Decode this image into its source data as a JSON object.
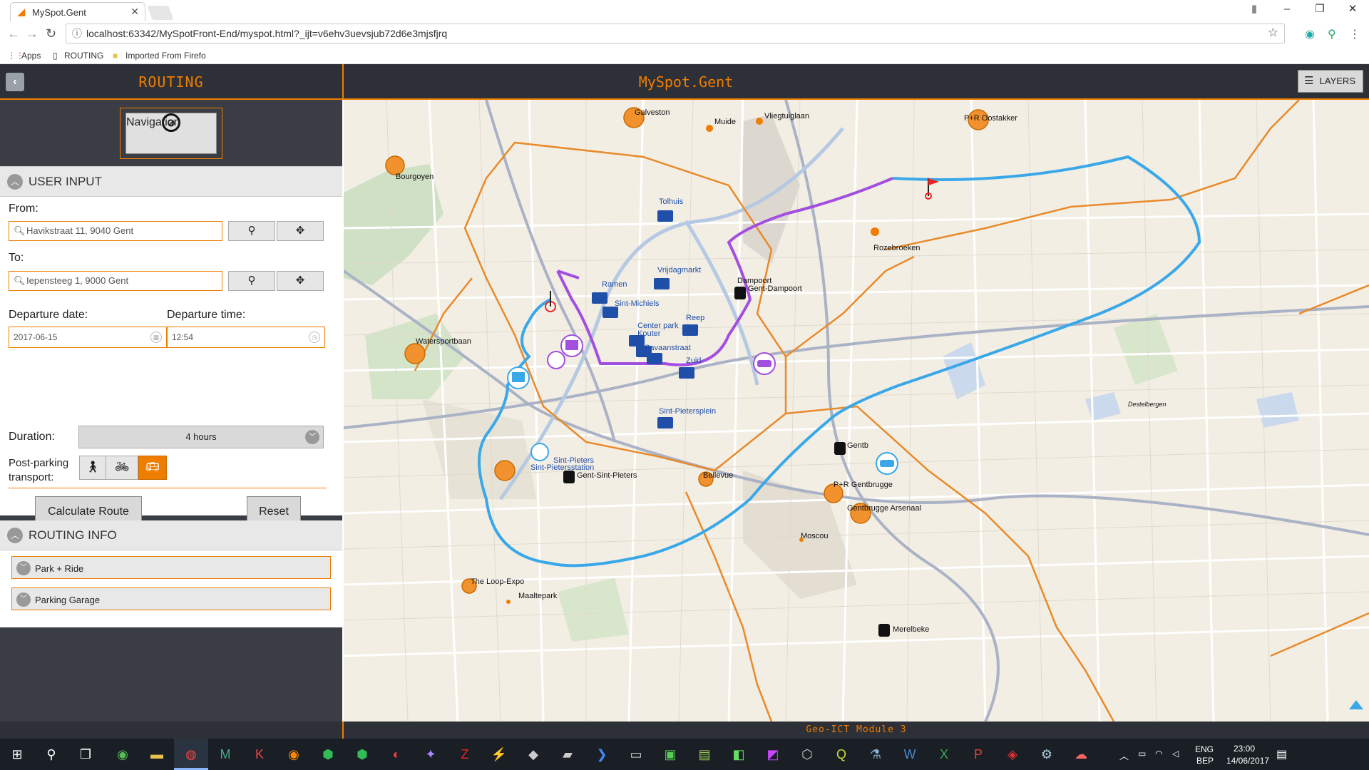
{
  "browser": {
    "tab_title": "MySpot.Gent",
    "tab_close": "✕",
    "url": "localhost:63342/MySpotFront-End/myspot.html?_ijt=v6ehv3uevsjub72d6e3mjsfjrq",
    "bookmarks": {
      "apps": "Apps",
      "routing": "ROUTING",
      "imported": "Imported From Firefo"
    }
  },
  "sidebar": {
    "title": "ROUTING",
    "back_icon": "‹",
    "navigation_label": "Navigation",
    "navigation_icon": "⊘",
    "user_input": {
      "header": "USER INPUT",
      "from_label": "From:",
      "from_value": "Havikstraat 11, 9040 Gent",
      "to_label": "To:",
      "to_value": "Iepensteeg 1, 9000 Gent",
      "departure_date_label": "Departure date:",
      "departure_date_value": "2017-06-15",
      "departure_time_label": "Departure time:",
      "departure_time_value": "12:54",
      "duration_label": "Duration:",
      "duration_value": "4 hours",
      "post_parking_label": "Post-parking transport:",
      "calculate_label": "Calculate Route",
      "reset_label": "Reset"
    },
    "routing_info": {
      "header": "ROUTING INFO",
      "items": [
        {
          "label": "Park + Ride"
        },
        {
          "label": "Parking Garage"
        }
      ]
    }
  },
  "main": {
    "title": "MySpot.Gent",
    "layers_label": "LAYERS",
    "footer": "Geo-ICT Module 3"
  },
  "map_labels": {
    "pr": [
      "Galveston",
      "Bourgoyen",
      "Watersportbaan",
      "P+R Oostakker",
      "Bellevue",
      "P+R Gentbrugge",
      "Gentbrugge Arsenaal",
      "The Loop-Expo"
    ],
    "garages": [
      "Tolhuis",
      "Vrijdagmarkt",
      "Ramen",
      "Sint-Michiels",
      "Reep",
      "Center park Kouter",
      "Savaanstraat",
      "Zuid",
      "Sint-Pietersplein"
    ],
    "stations": [
      "Dampoort",
      "Gent-Dampoort",
      "Gent-Sint-Pieters",
      "Gentbrugge",
      "Merelbeke"
    ],
    "places": [
      "Muide",
      "Vliegtuiglaan",
      "Rozebroeken",
      "Moscou",
      "Maaltepark",
      "Destelbergen",
      "Sint-Pieters",
      "Sint-Pietersstation"
    ]
  },
  "colors": {
    "accent": "#ef7d00",
    "route_blue": "#3aa8e8",
    "route_purple": "#a24fe0",
    "boundary": "#e88a2a"
  },
  "taskbar": {
    "language": "ENG",
    "layout": "BEP",
    "time": "23:00",
    "date": "14/06/2017"
  }
}
